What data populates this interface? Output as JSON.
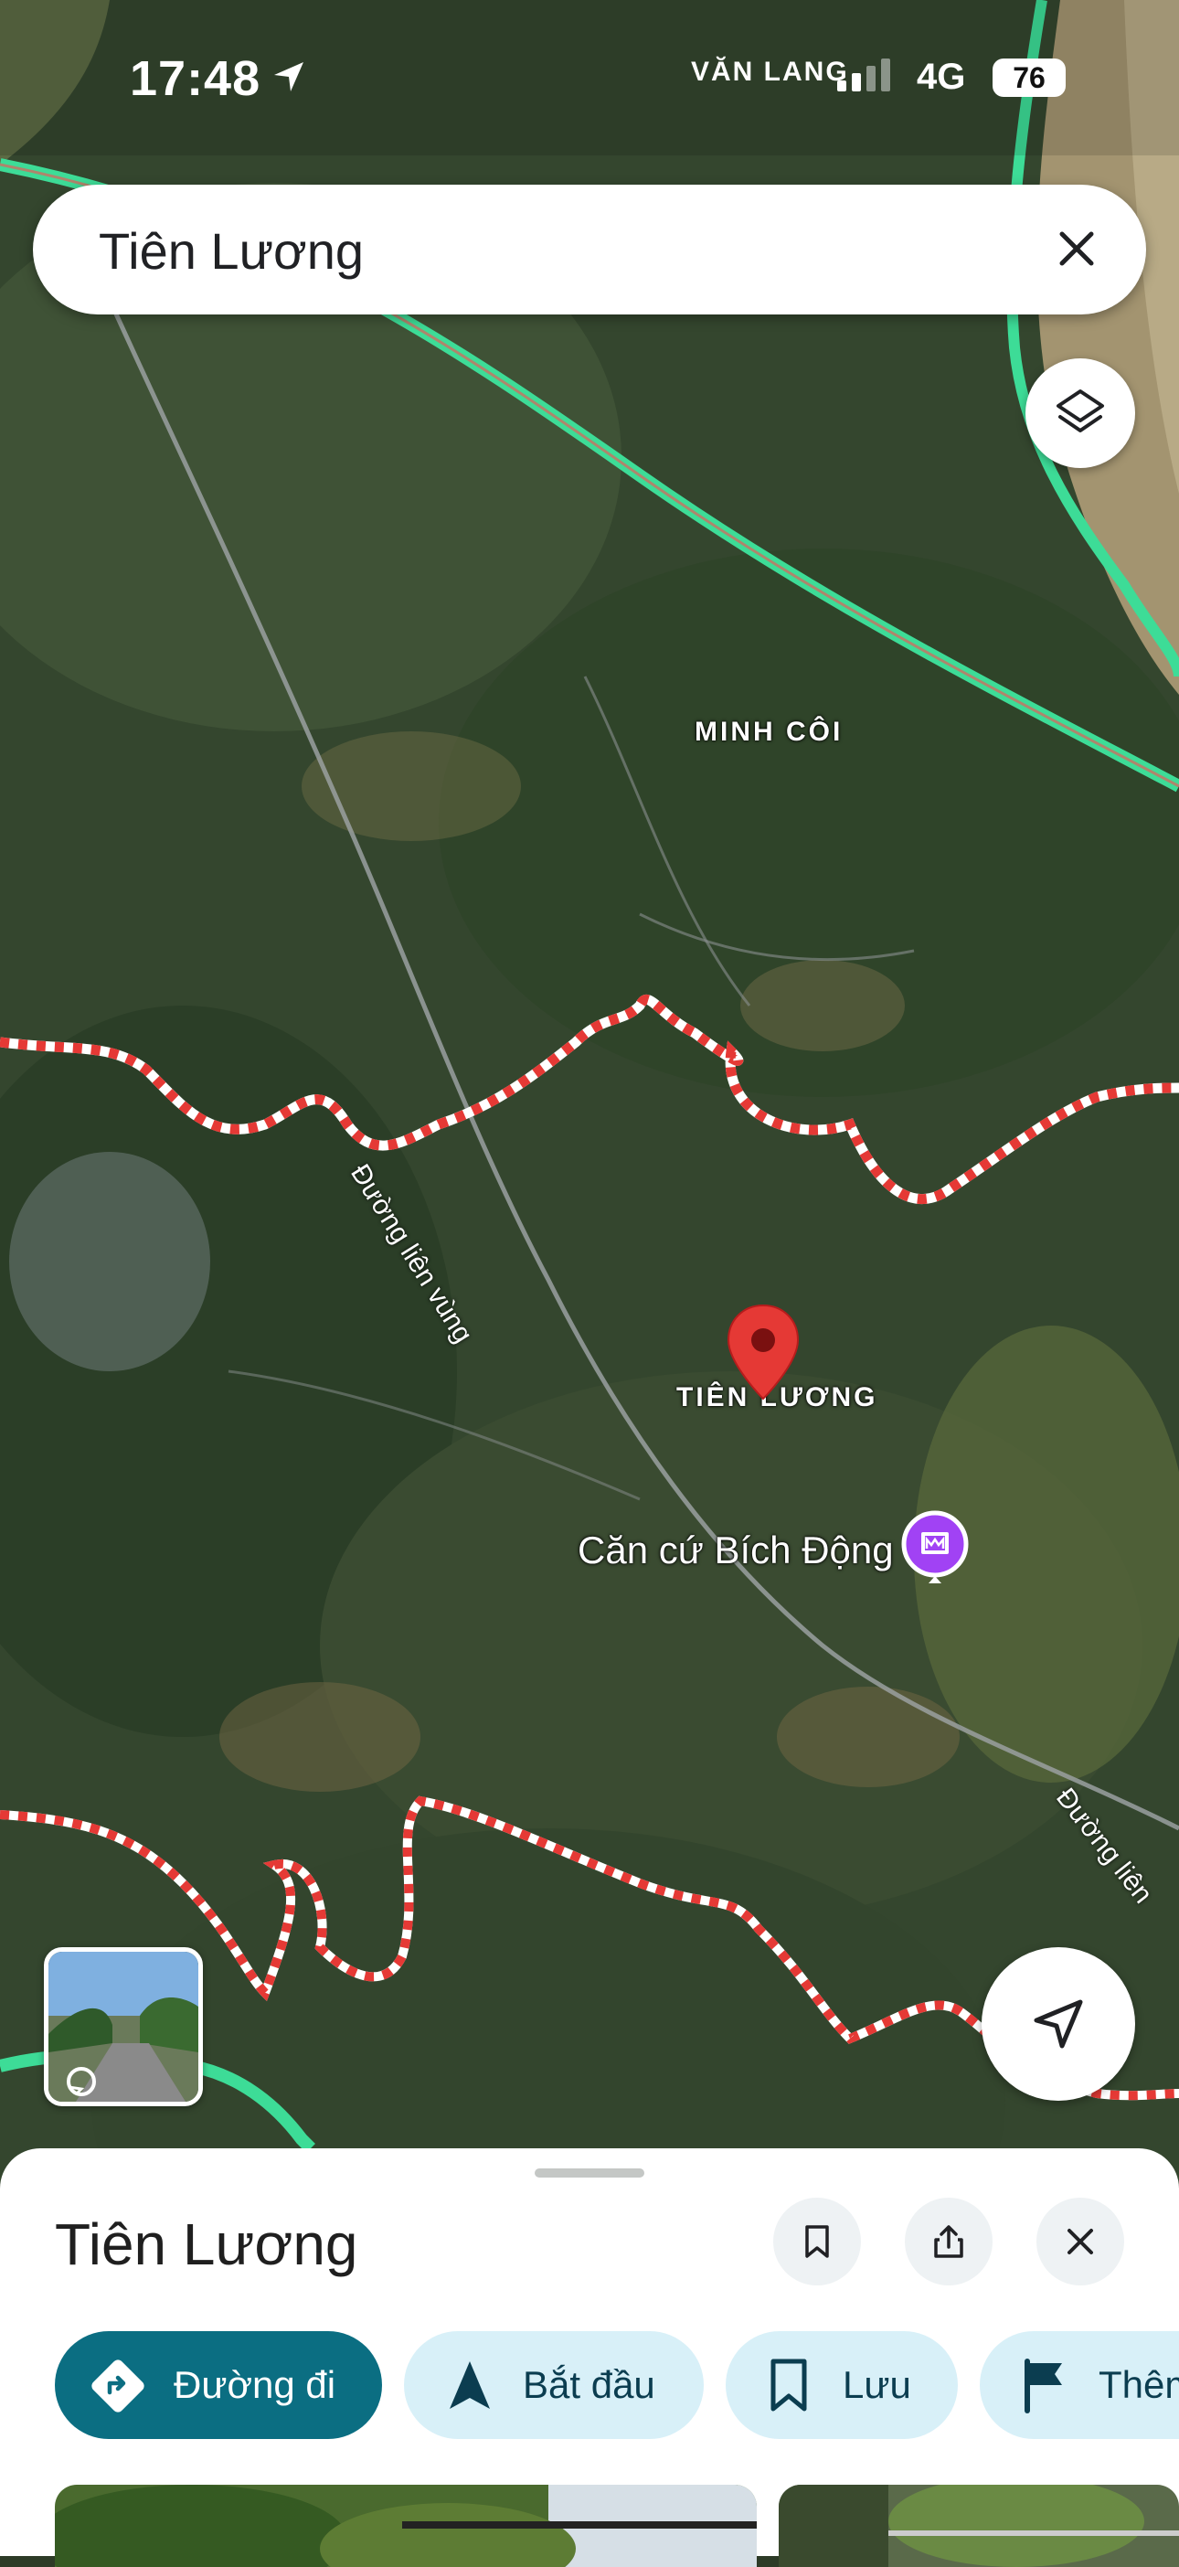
{
  "status_bar": {
    "time": "17:48",
    "network": "4G",
    "battery": "76"
  },
  "search": {
    "query": "Tiên Lương"
  },
  "map": {
    "labels": {
      "top_place": "VĂN LANG",
      "minh_coi": "MINH CÔI",
      "tien_luong": "TIÊN LƯƠNG",
      "poi_name": "Căn cứ Bích Động",
      "road_1": "Đường liên vùng",
      "road_2": "Đường liên"
    },
    "pin_color": "#e53935",
    "boundary_color": "#e53935",
    "highway_color": "#3ddc97",
    "poi_color": "#a142f4"
  },
  "place_sheet": {
    "title": "Tiên Lương",
    "actions": [
      {
        "label": "Đường đi",
        "icon": "directions-icon"
      },
      {
        "label": "Bắt đầu",
        "icon": "navigation-icon"
      },
      {
        "label": "Lưu",
        "icon": "bookmark-icon"
      },
      {
        "label": "Thêm",
        "icon": "flag-icon"
      }
    ]
  }
}
